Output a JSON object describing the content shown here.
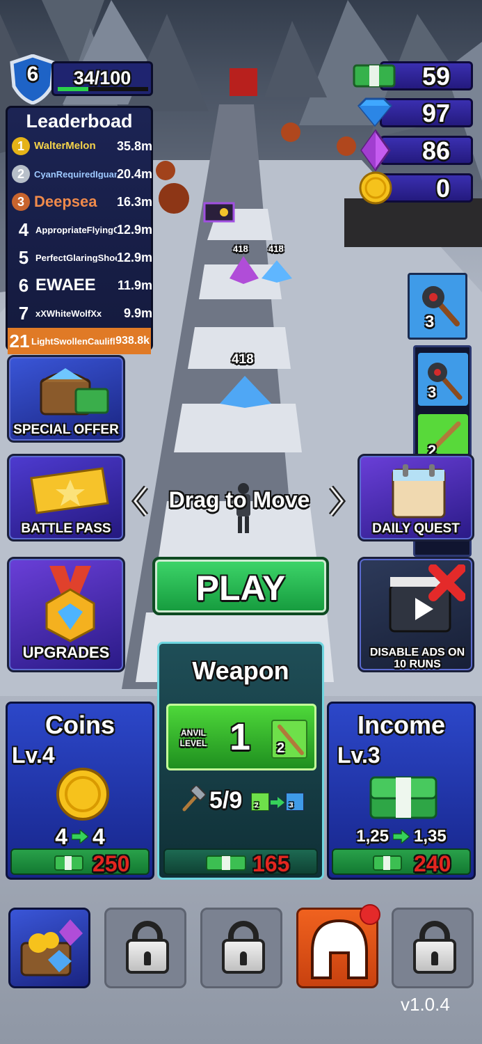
{
  "player": {
    "level": "6",
    "xp": "34/100",
    "xp_fraction": 0.34
  },
  "resources": [
    {
      "name": "cash",
      "value": "59",
      "icon": "cash-icon"
    },
    {
      "name": "diamond",
      "value": "97",
      "icon": "blue-diamond-icon"
    },
    {
      "name": "gem",
      "value": "86",
      "icon": "purple-gem-icon"
    },
    {
      "name": "coin",
      "value": "0",
      "icon": "gold-coin-icon"
    }
  ],
  "leaderboard": {
    "title": "Leaderboad",
    "rows": [
      {
        "rank": "1",
        "name": "WalterMelon",
        "value": "35.8m"
      },
      {
        "rank": "2",
        "name": "CyanRequiredIguana",
        "value": "20.4m"
      },
      {
        "rank": "3",
        "name": "Deepsea",
        "value": "16.3m"
      },
      {
        "rank": "4",
        "name": "AppropriateFlyingCabbage",
        "value": "12.9m"
      },
      {
        "rank": "5",
        "name": "PerfectGlaringShoe",
        "value": "12.9m"
      },
      {
        "rank": "6",
        "name": "EWAEE",
        "value": "11.9m"
      },
      {
        "rank": "7",
        "name": "xXWhiteWolfXx",
        "value": "9.9m"
      },
      {
        "rank": "21",
        "name": "LightSwollenCauliflower",
        "value": "938.8k"
      }
    ]
  },
  "track": {
    "pickup_values": [
      "418",
      "418",
      "418",
      "418"
    ]
  },
  "weapon_slots": [
    {
      "count": "3"
    },
    {
      "count": "3"
    },
    {
      "count": "2"
    }
  ],
  "buttons": {
    "special_offer": "SPECIAL OFFER",
    "battle_pass": "BATTLE PASS",
    "daily_quest": "DAILY QUEST",
    "upgrades": "UPGRADES",
    "disable_ads": "DISABLE ADS ON 10 RUNS",
    "play": "PLAY",
    "drag_hint": "Drag to Move"
  },
  "cards": {
    "coins": {
      "title": "Coins",
      "level": "Lv.4",
      "from": "4",
      "to": "4",
      "price": "250"
    },
    "weapon": {
      "title": "Weapon",
      "anvil_label": "ANVIL LEVEL",
      "anvil_level": "1",
      "weapon_level": "2",
      "progress": "5/9",
      "mini_from": "2",
      "mini_to": "3",
      "price": "165"
    },
    "income": {
      "title": "Income",
      "level": "Lv.3",
      "from": "1,25",
      "to": "1,35",
      "price": "240"
    }
  },
  "version": "v1.0.4",
  "colors": {
    "accent_green": "#22c55e",
    "price_red": "#e3261f",
    "panel_blue": "#2f3fb6",
    "orange": "#e8581a"
  }
}
